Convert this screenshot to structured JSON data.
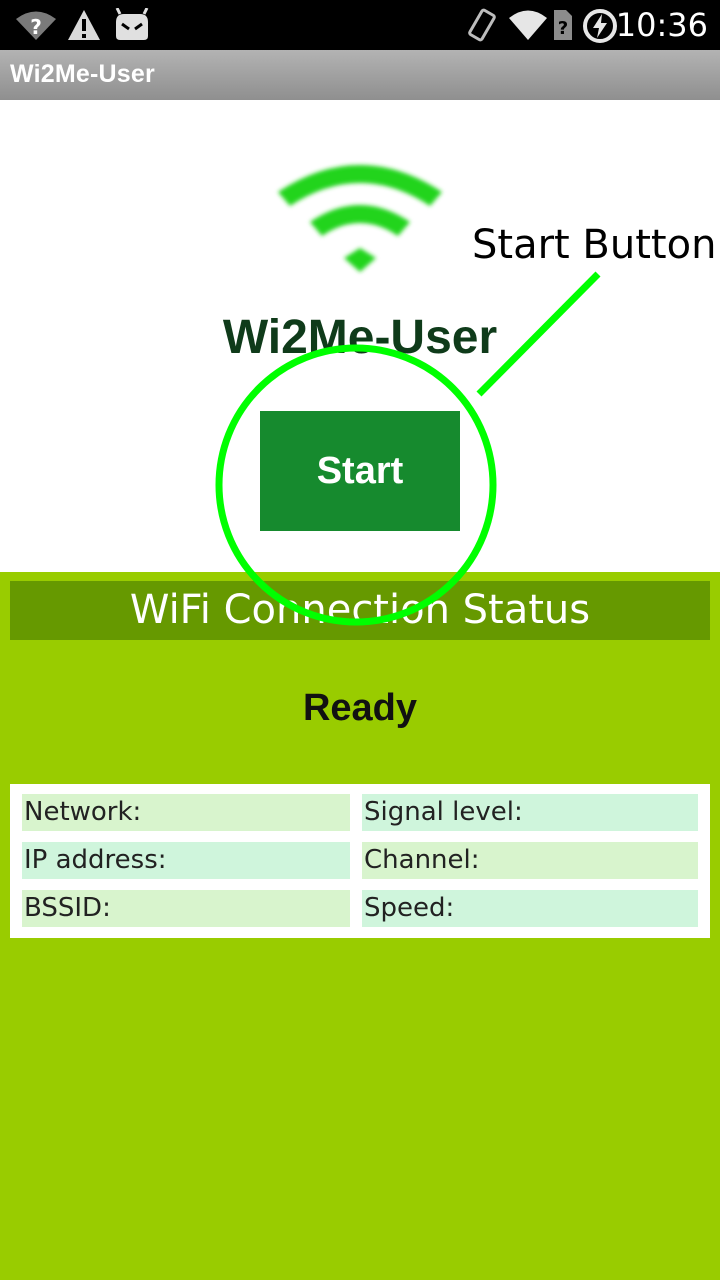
{
  "status_bar": {
    "time": "10:36",
    "icons": [
      "wifi-question-icon",
      "warning-icon",
      "android-robot-icon",
      "rotate-phone-icon",
      "wifi-icon",
      "sim-unknown-icon",
      "battery-charging-icon"
    ]
  },
  "action_bar": {
    "title": "Wi2Me-User"
  },
  "hero": {
    "app_name": "Wi2Me-User",
    "start_label": "Start"
  },
  "annotation": {
    "label": "Start Button"
  },
  "wifi_panel": {
    "header": "WiFi Connection Status",
    "status": "Ready",
    "fields": {
      "network": "Network:",
      "signal_level": "Signal level:",
      "ip_address": "IP address:",
      "channel": "Channel:",
      "bssid": "BSSID:",
      "speed": "Speed:"
    }
  },
  "colors": {
    "start_button": "#168a2e",
    "panel_background": "#99cc00",
    "panel_header": "#669900",
    "annotation": "#00ff00"
  }
}
